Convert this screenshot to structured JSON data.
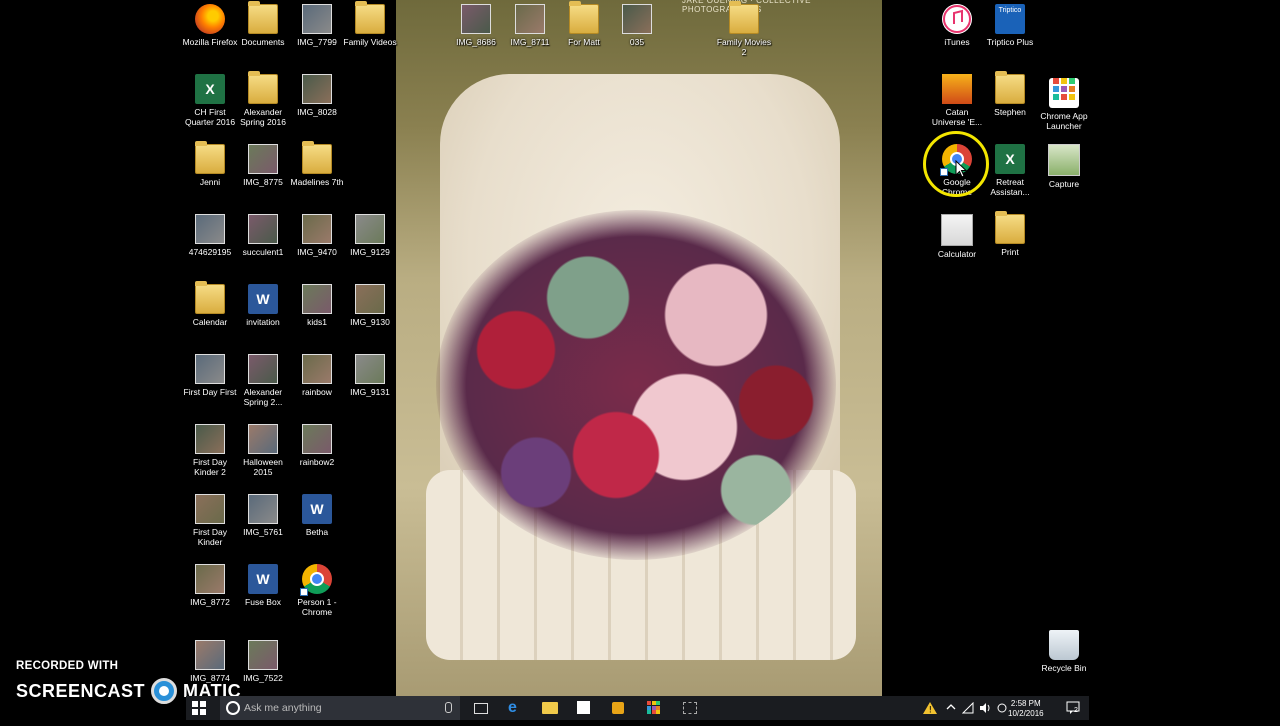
{
  "wallpaper": {
    "credit": "JAKE OUENING · COLLECTIVE PHOTOGRAPHERS"
  },
  "desktop": {
    "left_icons": [
      {
        "label": "Mozilla Firefox",
        "type": "firefox"
      },
      {
        "label": "Documents",
        "type": "folder"
      },
      {
        "label": "IMG_7799",
        "type": "photo"
      },
      {
        "label": "Family Videos",
        "type": "folder"
      },
      {
        "label": "CH First Quarter 2016",
        "type": "excel"
      },
      {
        "label": "Alexander Spring 2016",
        "type": "folder"
      },
      {
        "label": "IMG_8028",
        "type": "photo"
      },
      {
        "label": "Jenni",
        "type": "folder"
      },
      {
        "label": "IMG_8775",
        "type": "photo"
      },
      {
        "label": "Madelines 7th",
        "type": "folder"
      },
      {
        "label": "474629195",
        "type": "photo"
      },
      {
        "label": "succulent1",
        "type": "photo"
      },
      {
        "label": "IMG_9470",
        "type": "photo"
      },
      {
        "label": "IMG_9129",
        "type": "photo"
      },
      {
        "label": "Calendar",
        "type": "folder"
      },
      {
        "label": "invitation",
        "type": "word"
      },
      {
        "label": "kids1",
        "type": "photo"
      },
      {
        "label": "IMG_9130",
        "type": "photo"
      },
      {
        "label": "First Day First",
        "type": "photo"
      },
      {
        "label": "Alexander Spring 2...",
        "type": "photo"
      },
      {
        "label": "rainbow",
        "type": "photo"
      },
      {
        "label": "IMG_9131",
        "type": "photo"
      },
      {
        "label": "First Day Kinder 2",
        "type": "photo"
      },
      {
        "label": "Halloween 2015",
        "type": "photo"
      },
      {
        "label": "rainbow2",
        "type": "photo"
      },
      {
        "label": "First Day Kinder",
        "type": "photo"
      },
      {
        "label": "IMG_5761",
        "type": "photo"
      },
      {
        "label": "Betha",
        "type": "word"
      },
      {
        "label": "IMG_8772",
        "type": "photo"
      },
      {
        "label": "Fuse Box",
        "type": "word"
      },
      {
        "label": "Person 1 - Chrome",
        "type": "chrome"
      },
      {
        "label": "IMG_8774",
        "type": "photo"
      },
      {
        "label": "IMG_7522",
        "type": "photo"
      }
    ],
    "top_icons": [
      {
        "label": "IMG_8686",
        "type": "photo"
      },
      {
        "label": "IMG_8711",
        "type": "photo"
      },
      {
        "label": "For Matt",
        "type": "folder"
      },
      {
        "label": "035",
        "type": "photo"
      },
      {
        "label": "Family Movies 2",
        "type": "folder"
      }
    ],
    "right_icons": [
      {
        "label": "iTunes",
        "type": "itunes"
      },
      {
        "label": "Triptico Plus",
        "type": "triptico"
      },
      {
        "label": "Catan Universe 'E...",
        "type": "catan"
      },
      {
        "label": "Stephen",
        "type": "folder"
      },
      {
        "label": "Chrome App Launcher",
        "type": "launcher"
      },
      {
        "label": "Google Chrome",
        "type": "chrome"
      },
      {
        "label": "Retreat Assistan...",
        "type": "excel"
      },
      {
        "label": "Capture",
        "type": "capture"
      },
      {
        "label": "Calculator",
        "type": "calculator"
      },
      {
        "label": "Print",
        "type": "folder"
      }
    ],
    "recycle_bin": {
      "label": "Recycle Bin"
    },
    "triptico_badge": "Triptico"
  },
  "watermark": {
    "line1": "RECORDED WITH",
    "line2_a": "SCREENCAST",
    "line2_b": "MATIC"
  },
  "taskbar": {
    "search_placeholder": "Ask me anything",
    "clock_time": "2:58 PM",
    "clock_date": "10/2/2016",
    "notification_count": "2"
  },
  "colors": {
    "highlight": "#f3e600",
    "taskbar": "#1a1c20",
    "desktop_bg": "#000000"
  }
}
